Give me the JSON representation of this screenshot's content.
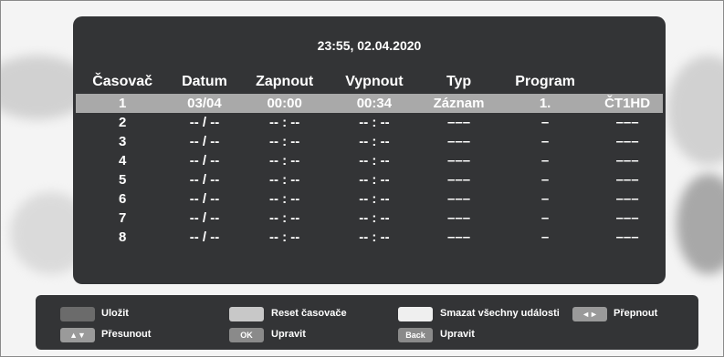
{
  "clock": "23:55, 02.04.2020",
  "columns": [
    "Časovač",
    "Datum",
    "Zapnout",
    "Vypnout",
    "Typ",
    "Program",
    ""
  ],
  "rows": [
    [
      "1",
      "03/04",
      "00:00",
      "00:34",
      "Záznam",
      "1.",
      "ČT1HD"
    ],
    [
      "2",
      "-- / --",
      "-- : --",
      "-- : --",
      "–––",
      "–",
      "–––"
    ],
    [
      "3",
      "-- / --",
      "-- : --",
      "-- : --",
      "–––",
      "–",
      "–––"
    ],
    [
      "4",
      "-- / --",
      "-- : --",
      "-- : --",
      "–––",
      "–",
      "–––"
    ],
    [
      "5",
      "-- / --",
      "-- : --",
      "-- : --",
      "–––",
      "–",
      "–––"
    ],
    [
      "6",
      "-- / --",
      "-- : --",
      "-- : --",
      "–––",
      "–",
      "–––"
    ],
    [
      "7",
      "-- / --",
      "-- : --",
      "-- : --",
      "–––",
      "–",
      "–––"
    ],
    [
      "8",
      "-- / --",
      "-- : --",
      "-- : --",
      "–––",
      "–",
      "–––"
    ]
  ],
  "selected_row": 0,
  "legend": {
    "save_label": "Uložit",
    "reset_label": "Reset časovače",
    "delete_all_label": "Smazat všechny události",
    "switch_key": "◄►",
    "switch_label": "Přepnout",
    "move_key": "▲▼",
    "move_label": "Přesunout",
    "ok_key": "OK",
    "ok_label": "Upravit",
    "back_key": "Back",
    "back_label": "Upravit"
  },
  "colors": {
    "panel": "#333436",
    "selected_row": "#a9a9a9",
    "save_key": "#6b6b6b",
    "reset_key": "#c8c8c8",
    "delete_key": "#efefef"
  }
}
